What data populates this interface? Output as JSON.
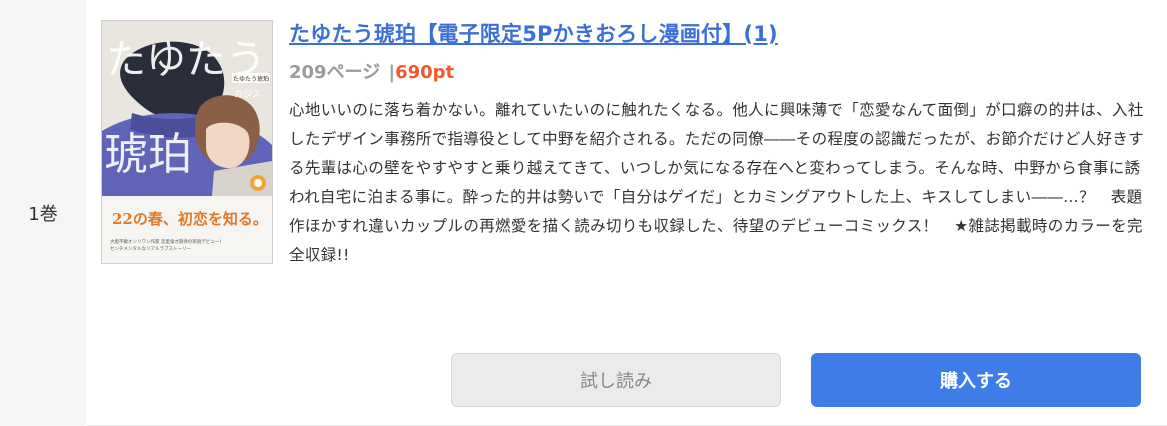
{
  "volume": {
    "label": "1巻"
  },
  "book": {
    "title": "たゆたう琥珀【電子限定5Pかきおろし漫画付】(1)",
    "pages": "209ページ",
    "separator": "|",
    "price": "690pt",
    "description": "心地いいのに落ち着かない。離れていたいのに触れたくなる。他人に興味薄で「恋愛なんて面倒」が口癖の的井は、入社したデザイン事務所で指導役として中野を紹介される。ただの同僚――その程度の認識だったが、お節介だけど人好きする先輩は心の壁をやすやすと乗り越えてきて、いつしか気になる存在へと変わってしまう。そんな時、中野から食事に誘われ自宅に泊まる事に。酔った的井は勢いで「自分はゲイだ」とカミングアウトした上、キスしてしまい――…？　表題作ほかすれ違いカップルの再燃愛を描く読み切りも収録した、待望のデビューコミックス！　★雑誌掲載時のカラーを完全収録!!"
  },
  "cover": {
    "title_art": "たゆたう",
    "title_art_big": "琥珀",
    "small_title": "たゆたう琥珀",
    "author": "カジス",
    "tagline": "22の春、初恋を知る。",
    "fine_print_1": "大胆不敵オンリワン作家 恋愛鬼才期待の新鋭デビュー!",
    "fine_print_2": "センチメンタルなリアルラブストーリー"
  },
  "buttons": {
    "trial": "試し読み",
    "buy": "購入する"
  },
  "colors": {
    "link": "#3b6fd8",
    "price": "#f0592a",
    "buy": "#3f7de6"
  }
}
